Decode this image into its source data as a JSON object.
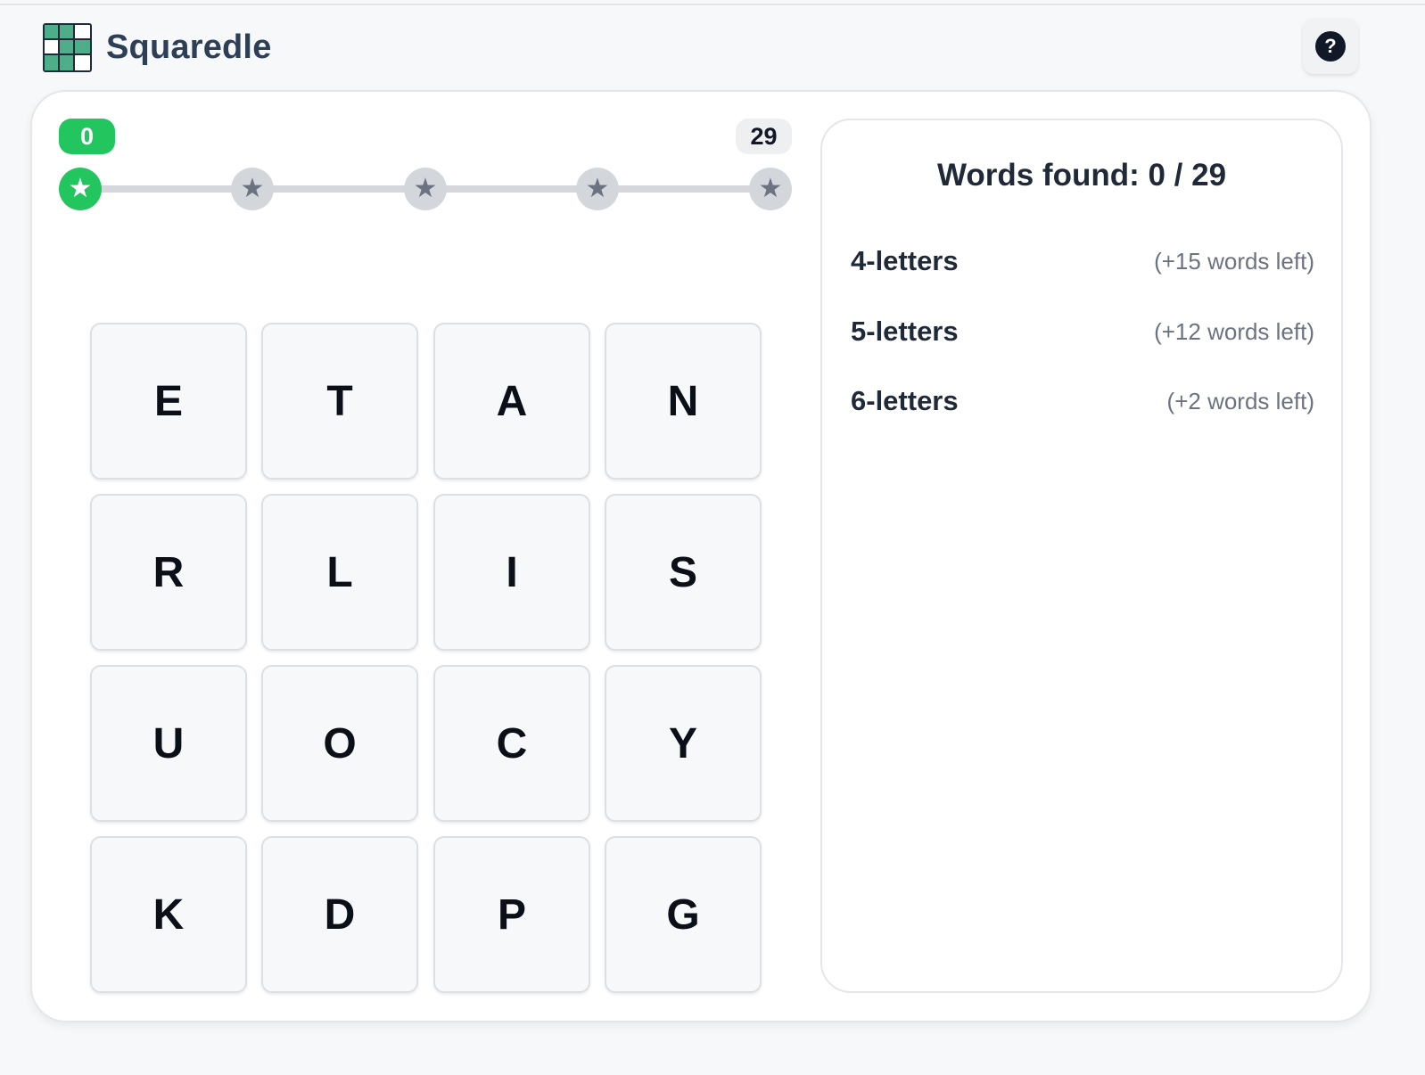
{
  "app": {
    "title": "Squaredle"
  },
  "header": {
    "help_icon": "question-circle-icon",
    "help_glyph": "?"
  },
  "progress": {
    "found": "0",
    "total": "29",
    "milestones": [
      {
        "state": "done",
        "icon": "star-icon"
      },
      {
        "state": "todo",
        "icon": "star-icon"
      },
      {
        "state": "todo",
        "icon": "star-icon"
      },
      {
        "state": "todo",
        "icon": "star-icon"
      },
      {
        "state": "todo",
        "icon": "star-icon"
      }
    ],
    "colors": {
      "done": "#22c55e",
      "todo": "#d3d6db"
    }
  },
  "grid": {
    "rows": [
      [
        "E",
        "T",
        "A",
        "N"
      ],
      [
        "R",
        "L",
        "I",
        "S"
      ],
      [
        "U",
        "O",
        "C",
        "Y"
      ],
      [
        "K",
        "D",
        "P",
        "G"
      ]
    ]
  },
  "panel": {
    "words_found": "Words found: 0 / 29",
    "lengths": [
      {
        "label": "4-letters",
        "left": "(+15 words left)"
      },
      {
        "label": "5-letters",
        "left": "(+12 words left)"
      },
      {
        "label": "6-letters",
        "left": "(+2 words left)"
      }
    ]
  }
}
